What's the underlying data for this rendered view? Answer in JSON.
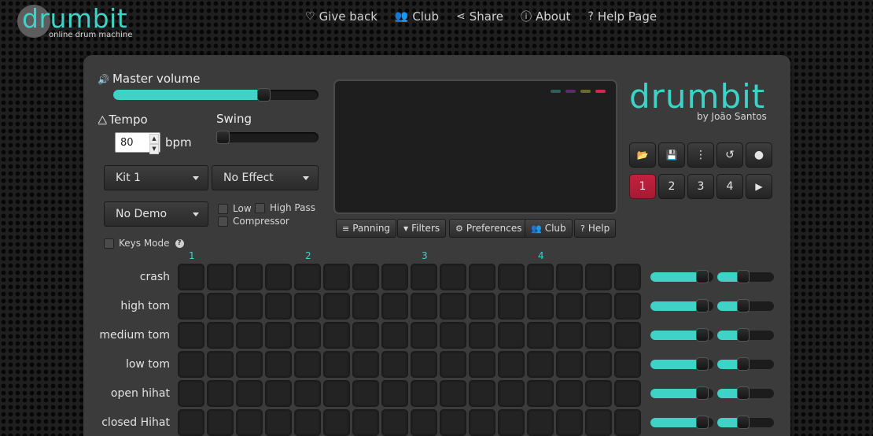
{
  "app": {
    "logo_text": "drumbit",
    "logo_sub": "online drum machine"
  },
  "nav": [
    {
      "icon": "heart-icon",
      "glyph": "♡",
      "label": "Give back"
    },
    {
      "icon": "users-icon",
      "glyph": "👥",
      "label": "Club"
    },
    {
      "icon": "share-icon",
      "glyph": "⋖",
      "label": "Share"
    },
    {
      "icon": "info-icon",
      "glyph": "ⓘ",
      "label": "About"
    },
    {
      "icon": "question-icon",
      "glyph": "?",
      "label": "Help Page"
    }
  ],
  "controls": {
    "master_volume_label": "Master volume",
    "master_volume": 0.75,
    "tempo_label": "Tempo",
    "tempo_value": "80",
    "bpm_label": "bpm",
    "swing_label": "Swing",
    "swing_value": 0.0,
    "kit": "Kit 1",
    "effect": "No Effect",
    "demo": "No Demo",
    "low_label": "Low",
    "high_pass_label": "High Pass",
    "compressor_label": "Compressor",
    "keys_mode_label": "Keys Mode"
  },
  "screen": {
    "indicator_colors": [
      "#2d5f5c",
      "#5b2c6b",
      "#6b6b2e",
      "#d3264b"
    ]
  },
  "screen_buttons": [
    {
      "icon": "sliders-icon",
      "glyph": "≡",
      "label": "Panning"
    },
    {
      "icon": "filter-icon",
      "glyph": "▼",
      "label": "Filters"
    },
    {
      "icon": "gear-icon",
      "glyph": "⚙",
      "label": "Preferences"
    },
    {
      "icon": "users-icon",
      "glyph": "👥",
      "label": "Club"
    },
    {
      "icon": "question-icon",
      "glyph": "?",
      "label": "Help"
    }
  ],
  "brand": {
    "title": "drumbit",
    "by": "by João Santos"
  },
  "toolbar": [
    {
      "icon": "folder-open-icon",
      "glyph": "📂"
    },
    {
      "icon": "save-icon",
      "glyph": "💾"
    },
    {
      "icon": "more-vertical-icon",
      "glyph": "⋮"
    },
    {
      "icon": "undo-icon",
      "glyph": "↺"
    },
    {
      "icon": "record-icon",
      "glyph": "●"
    }
  ],
  "patterns": [
    "1",
    "2",
    "3",
    "4"
  ],
  "play_glyph": "▶",
  "active_pattern": 0,
  "beats": [
    "1",
    "2",
    "3",
    "4"
  ],
  "tracks": [
    {
      "name": "crash",
      "volume": 0.9,
      "pan": 0.45
    },
    {
      "name": "high tom",
      "volume": 0.9,
      "pan": 0.45
    },
    {
      "name": "medium tom",
      "volume": 0.9,
      "pan": 0.45
    },
    {
      "name": "low tom",
      "volume": 0.9,
      "pan": 0.45
    },
    {
      "name": "open hihat",
      "volume": 0.9,
      "pan": 0.45
    },
    {
      "name": "closed Hihat",
      "volume": 0.9,
      "pan": 0.45
    }
  ],
  "colors": {
    "accent": "#3fd2c7",
    "active_pattern": "#c4213f"
  }
}
